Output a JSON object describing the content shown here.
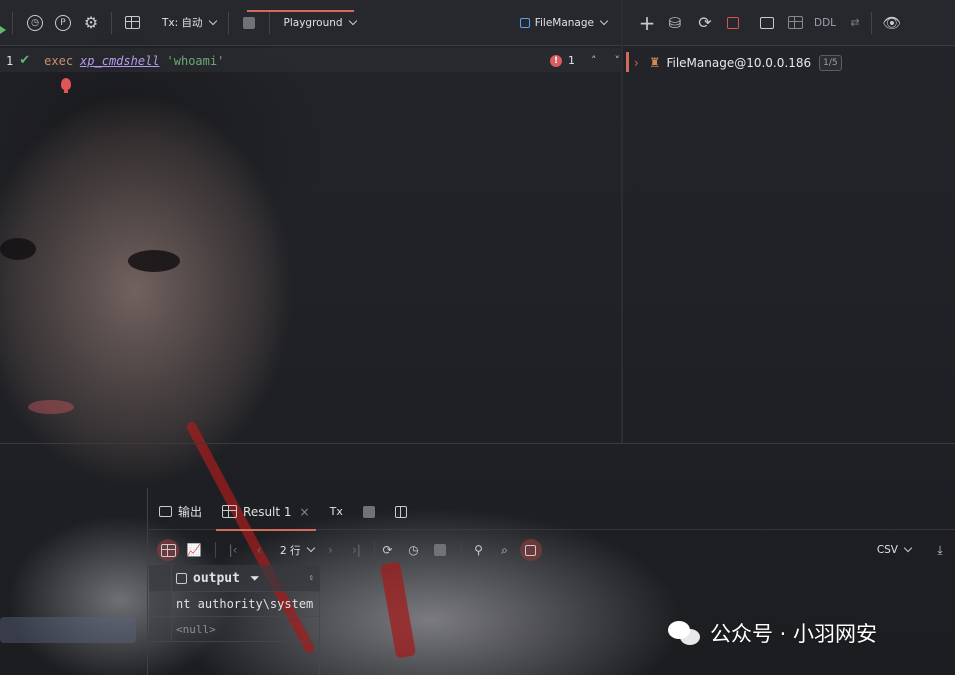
{
  "toolbar": {
    "tx_mode": "Tx: 自动",
    "playground": "Playground",
    "datasource": "FileManage"
  },
  "right_toolbar": {
    "ddl": "DDL"
  },
  "editor": {
    "line_number": "1",
    "code_exec": "exec",
    "code_proc": "xp_cmdshell",
    "code_arg": "'whoami'",
    "error_count": "1"
  },
  "session": {
    "name": "FileManage@10.0.0.186",
    "badge": "1/5"
  },
  "results": {
    "tab_output": "输出",
    "tab_result": "Result 1",
    "tx_label": "Tx",
    "rows_label": "2 行",
    "export_format": "CSV",
    "column": "output",
    "rows": [
      "nt authority\\system",
      "<null>"
    ]
  },
  "watermark": {
    "text": "公众号 · 小羽网安"
  },
  "colors": {
    "accent": "#d16b5a",
    "keyword": "#cf8e6d",
    "procedure": "#b39cf0",
    "string": "#6aab73",
    "error": "#db5c5c"
  }
}
